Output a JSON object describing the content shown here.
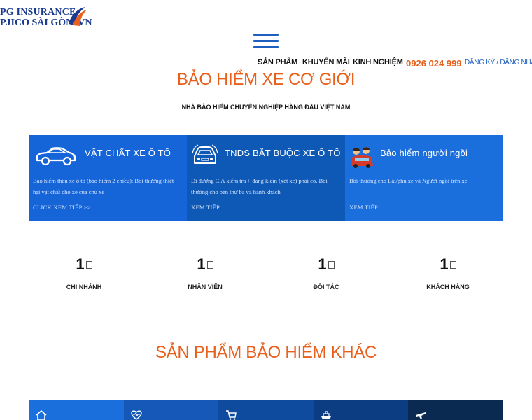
{
  "logo": {
    "line1": "PG INSURANCE",
    "line2": "PJICO SÀI GÒN .VN"
  },
  "nav": {
    "items": [
      "SẢN PHẨM",
      "KHUYẾN MÃI",
      "KINH NGHIỆM"
    ],
    "phone": "0926 024 999",
    "auth": "ĐĂNG KÝ / ĐĂNG NHẬP"
  },
  "hero": {
    "title": "BẢO HIỂM XE CƠ GIỚI",
    "subtitle": "NHÀ BẢO HIỂM CHUYÊN NGHIỆP HÀNG ĐẦU VIỆT NAM"
  },
  "cards": [
    {
      "title": "VẬT CHẤT XE Ô TÔ",
      "desc": "Bảo hiểm thân xe ô tô (bảo hiểm 2 chiều): Bồi thường thiệt hại vật chất cho xe của chủ xe",
      "link": "CLICK XEM TIẾP >>",
      "icon": "car-outline-icon",
      "color": "#1565d8"
    },
    {
      "title": "TNDS BẮT BUỘC XE Ô TÔ",
      "desc": "Di đường C.A kiểm tra + đăng kiểm (xét xe) phải có. Bồi thường cho bên thứ ba và hành khách",
      "link": "XEM TIẾP",
      "icon": "car-front-icon",
      "color": "#0e58b6"
    },
    {
      "title": "Bảo hiểm người ngồi",
      "desc": "Bồi thường cho Lái/phụ xe và Người ngồi trên xe",
      "link": "XEM TIẾP",
      "icon": "passengers-car-icon",
      "color": "#1a6fdc"
    }
  ],
  "stats": [
    {
      "value": "1",
      "label": "CHI NHÁNH"
    },
    {
      "value": "1",
      "label": "NHÂN VIÊN"
    },
    {
      "value": "1",
      "label": "ĐỐI TÁC"
    },
    {
      "value": "1",
      "label": "KHÁCH HÀNG"
    }
  ],
  "products": {
    "title": "SẢN PHẨM BẢO HIỂM KHÁC",
    "tiles": [
      {
        "icon": "home-icon",
        "color": "#1a6fdc"
      },
      {
        "icon": "heart-pulse-icon",
        "color": "#1558b8"
      },
      {
        "icon": "cart-icon",
        "color": "#0e4a9e"
      },
      {
        "icon": "ship-icon",
        "color": "#0c3d82"
      },
      {
        "icon": "plane-icon",
        "color": "#0a2a52"
      }
    ]
  },
  "colors": {
    "accent": "#e8601c",
    "brand_blue": "#1565d8"
  }
}
